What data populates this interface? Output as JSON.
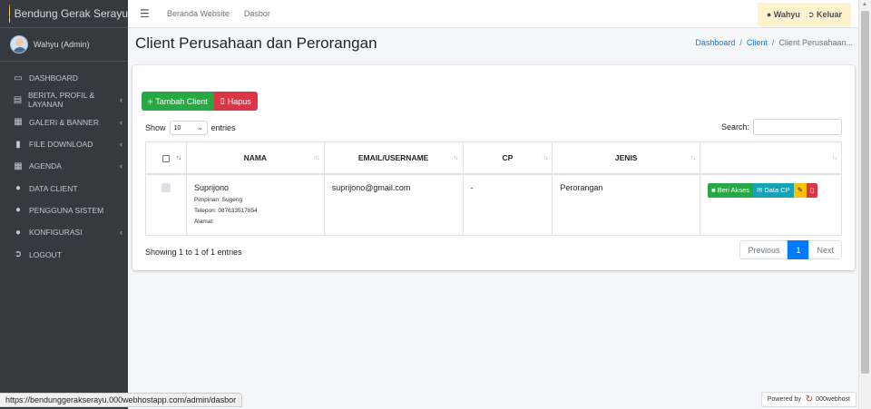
{
  "app": {
    "brand": "Bendung Gerak Serayu"
  },
  "user_panel": {
    "name": "Wahyu (Admin)"
  },
  "sidebar": {
    "items": [
      {
        "label": "DASHBOARD",
        "icon": "monitor-icon",
        "has_submenu": false
      },
      {
        "label": "BERITA, PROFIL & LAYANAN",
        "icon": "newspaper-icon",
        "has_submenu": true
      },
      {
        "label": "GALERI & BANNER",
        "icon": "image-icon",
        "has_submenu": true
      },
      {
        "label": "FILE DOWNLOAD",
        "icon": "file-icon",
        "has_submenu": true
      },
      {
        "label": "AGENDA",
        "icon": "calendar-icon",
        "has_submenu": true
      },
      {
        "label": "DATA CLIENT",
        "icon": "users-icon",
        "has_submenu": false
      },
      {
        "label": "PENGGUNA SISTEM",
        "icon": "user-icon",
        "has_submenu": false
      },
      {
        "label": "KONFIGURASI",
        "icon": "user-icon",
        "has_submenu": true
      },
      {
        "label": "LOGOUT",
        "icon": "logout-icon",
        "has_submenu": false
      }
    ]
  },
  "topbar": {
    "links": [
      "Beranda Website",
      "Dasbor"
    ],
    "user_label": "Wahyu",
    "logout_label": "Keluar"
  },
  "page": {
    "title": "Client Perusahaan dan Perorangan",
    "breadcrumb": [
      "Dashboard",
      "Client",
      "Client Perusahaan..."
    ]
  },
  "actions": {
    "add_label": "Tambah Client",
    "delete_label": "Hapus"
  },
  "datatable": {
    "show_label": "Show",
    "entries_label": "entries",
    "page_size": "10",
    "search_label": "Search:",
    "search_value": "",
    "columns": [
      "",
      "NAMA",
      "EMAIL/USERNAME",
      "CP",
      "JENIS",
      ""
    ],
    "rows": [
      {
        "nama": "Suprijono",
        "pimpinan": "Pimpinan: Sugeng",
        "telepon": "Telepon: 087633517654",
        "alamat": "Alamat:",
        "email": "suprijono@gmail.com",
        "cp": "-",
        "jenis": "Perorangan",
        "btn_akses": "Beri Akses",
        "btn_data_cp": "Data CP"
      }
    ],
    "info": "Showing 1 to 1 of 1 entries",
    "pager": {
      "previous": "Previous",
      "current": "1",
      "next": "Next"
    }
  },
  "statusbar": {
    "url": "https://bendunggerakserayu.000webhostapp.com/admin/dasbor"
  },
  "powered": {
    "label": "Powered by",
    "host": "000webhost"
  },
  "colors": {
    "sidebar_bg": "#343a40",
    "green": "#28a745",
    "red": "#dc3545",
    "cyan": "#17a2b8",
    "yellow": "#ffc107",
    "blue": "#007bff",
    "user_box": "#fff3cd"
  }
}
